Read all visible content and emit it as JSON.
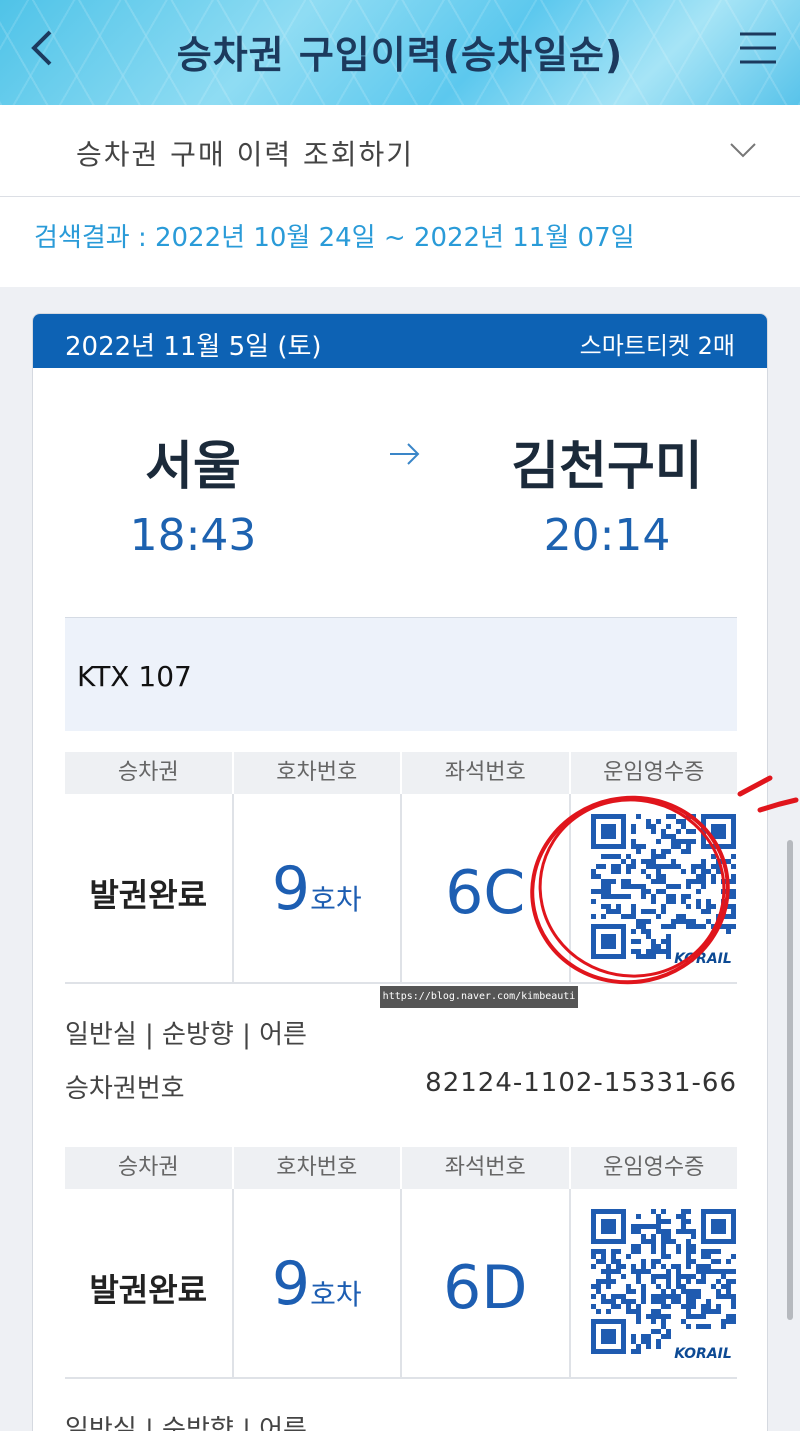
{
  "header": {
    "title": "승차권 구입이력(승차일순)"
  },
  "search": {
    "label": "승차권 구매 이력 조회하기"
  },
  "result": {
    "text": "검색결과 : 2022년 10월 24일 ~ 2022년 11월 07일"
  },
  "trip": {
    "date": "2022년 11월 5일 (토)",
    "ticket_count": "스마트티켓 2매",
    "departure": {
      "station": "서울",
      "time": "18:43"
    },
    "arrival": {
      "station": "김천구미",
      "time": "20:14"
    },
    "train": "KTX 107"
  },
  "table_headers": [
    "승차권",
    "호차번호",
    "좌석번호",
    "운임영수증"
  ],
  "tickets": [
    {
      "status": "발권완료",
      "car_num": "9",
      "car_unit": "호차",
      "seat": "6C",
      "qr_brand": "KORAIL",
      "info": "일반실 | 순방향 | 어른",
      "number_label": "승차권번호",
      "number": "82124-1102-15331-66"
    },
    {
      "status": "발권완료",
      "car_num": "9",
      "car_unit": "호차",
      "seat": "6D",
      "qr_brand": "KORAIL",
      "info": "일반실 | 순방향 | 어른"
    }
  ],
  "watermark": "https://blog.naver.com/kimbeauti",
  "colors": {
    "header_bar": "#0d62b4",
    "accent_blue": "#1d62b0",
    "link_blue": "#2a9bd8",
    "annotation_red": "#e0151c"
  }
}
